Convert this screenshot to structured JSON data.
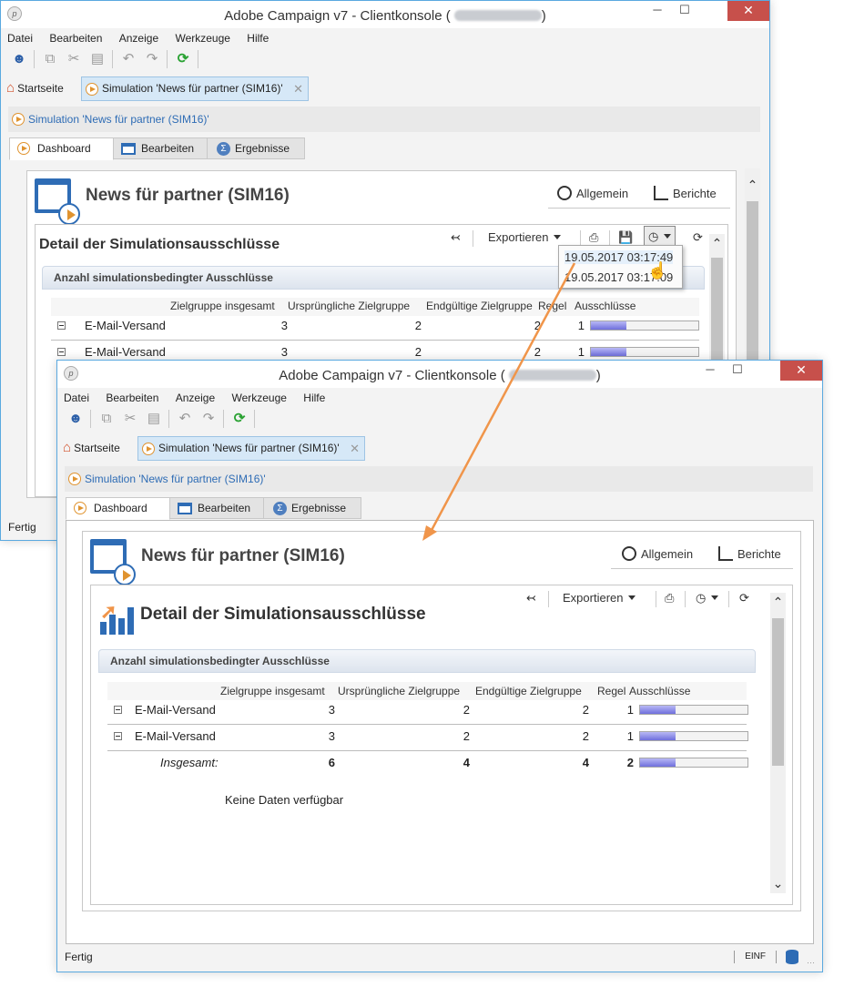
{
  "app": {
    "title": "Adobe Campaign v7 - Clientkonsole",
    "title_suffix_open": "(",
    "title_suffix_close": ")"
  },
  "menu": [
    "Datei",
    "Bearbeiten",
    "Anzeige",
    "Werkzeuge",
    "Hilfe"
  ],
  "window_controls": {
    "minimize": "─",
    "maximize": "☐",
    "close": "✕"
  },
  "tabs": {
    "home_label": "Startseite",
    "document_label": "Simulation 'News für partner (SIM16)'",
    "close_glyph": "✕"
  },
  "breadcrumb": "Simulation 'News für partner (SIM16)'",
  "subtabs": [
    "Dashboard",
    "Bearbeiten",
    "Ergebnisse"
  ],
  "dashboard": {
    "title": "News für partner (SIM16)",
    "link_general": "Allgemein",
    "link_reports": "Berichte"
  },
  "detail": {
    "title": "Detail der Simulationsausschlüsse",
    "export_label": "Exportieren",
    "section_title": "Anzahl simulationsbedingter Ausschlüsse",
    "columns": [
      "Zielgruppe insgesamt",
      "Ursprüngliche Zielgruppe",
      "Endgültige Zielgruppe",
      "Regel",
      "Ausschlüsse"
    ],
    "rows": [
      {
        "label": "E-Mail-Versand",
        "total": "3",
        "initial": "2",
        "final": "2",
        "rule": "1",
        "exclusion_fraction": 0.33
      },
      {
        "label": "E-Mail-Versand",
        "total": "3",
        "initial": "2",
        "final": "2",
        "rule": "1",
        "exclusion_fraction": 0.33
      }
    ],
    "total_row": {
      "label": "Insgesamt:",
      "total": "6",
      "initial": "4",
      "final": "4",
      "rule": "2",
      "exclusion_fraction": 0.33
    },
    "no_data": "Keine Daten verfügbar"
  },
  "history_dropdown": [
    "19.05.2017 03:17:49",
    "19.05.2017 03:17:09"
  ],
  "status": {
    "text": "Fertig",
    "mode": "EINF"
  },
  "colors": {
    "accent_blue": "#2e6cb5",
    "arrow_orange": "#f0954a",
    "close_red": "#c7504b",
    "bar_fill": "#6f6fdc"
  }
}
